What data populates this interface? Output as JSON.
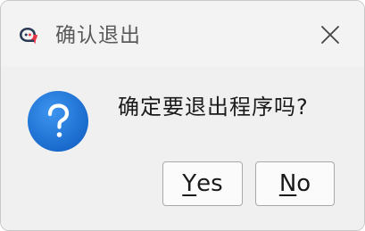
{
  "window": {
    "title": "确认退出",
    "app_icon": "chat-bubble-icon",
    "close_icon": "close-icon"
  },
  "dialog": {
    "icon": "question-icon",
    "icon_color": "#1a73d8",
    "message": "确定要退出程序吗?"
  },
  "buttons": {
    "yes_mnemonic": "Y",
    "yes_rest": "es",
    "no_mnemonic": "N",
    "no_rest": "o"
  }
}
